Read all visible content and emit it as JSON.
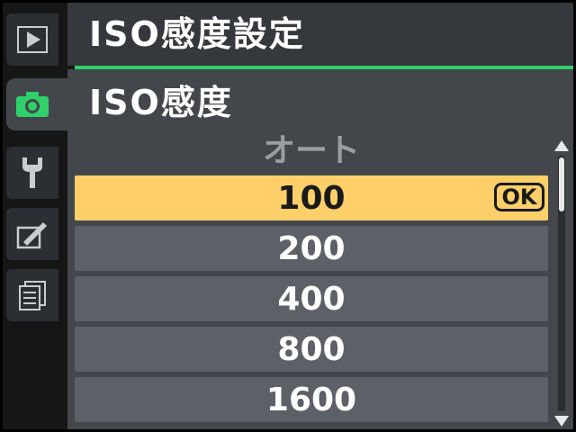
{
  "header": {
    "title": "ISO感度設定"
  },
  "section": {
    "title": "ISO感度"
  },
  "tabs": [
    {
      "icon": "playback-icon",
      "active": false
    },
    {
      "icon": "camera-icon",
      "active": true
    },
    {
      "icon": "wrench-icon",
      "active": false
    },
    {
      "icon": "retouch-icon",
      "active": false
    },
    {
      "icon": "recent-settings-icon",
      "active": false
    }
  ],
  "options": [
    {
      "label": "オート",
      "state": "disabled"
    },
    {
      "label": "100",
      "state": "selected",
      "badge": "OK"
    },
    {
      "label": "200",
      "state": "normal"
    },
    {
      "label": "400",
      "state": "normal"
    },
    {
      "label": "800",
      "state": "normal"
    },
    {
      "label": "1600",
      "state": "normal"
    }
  ],
  "colors": {
    "accent": "#2fd06a",
    "selection": "#ffd06a",
    "row": "#5d6167",
    "panel": "#43474c"
  }
}
